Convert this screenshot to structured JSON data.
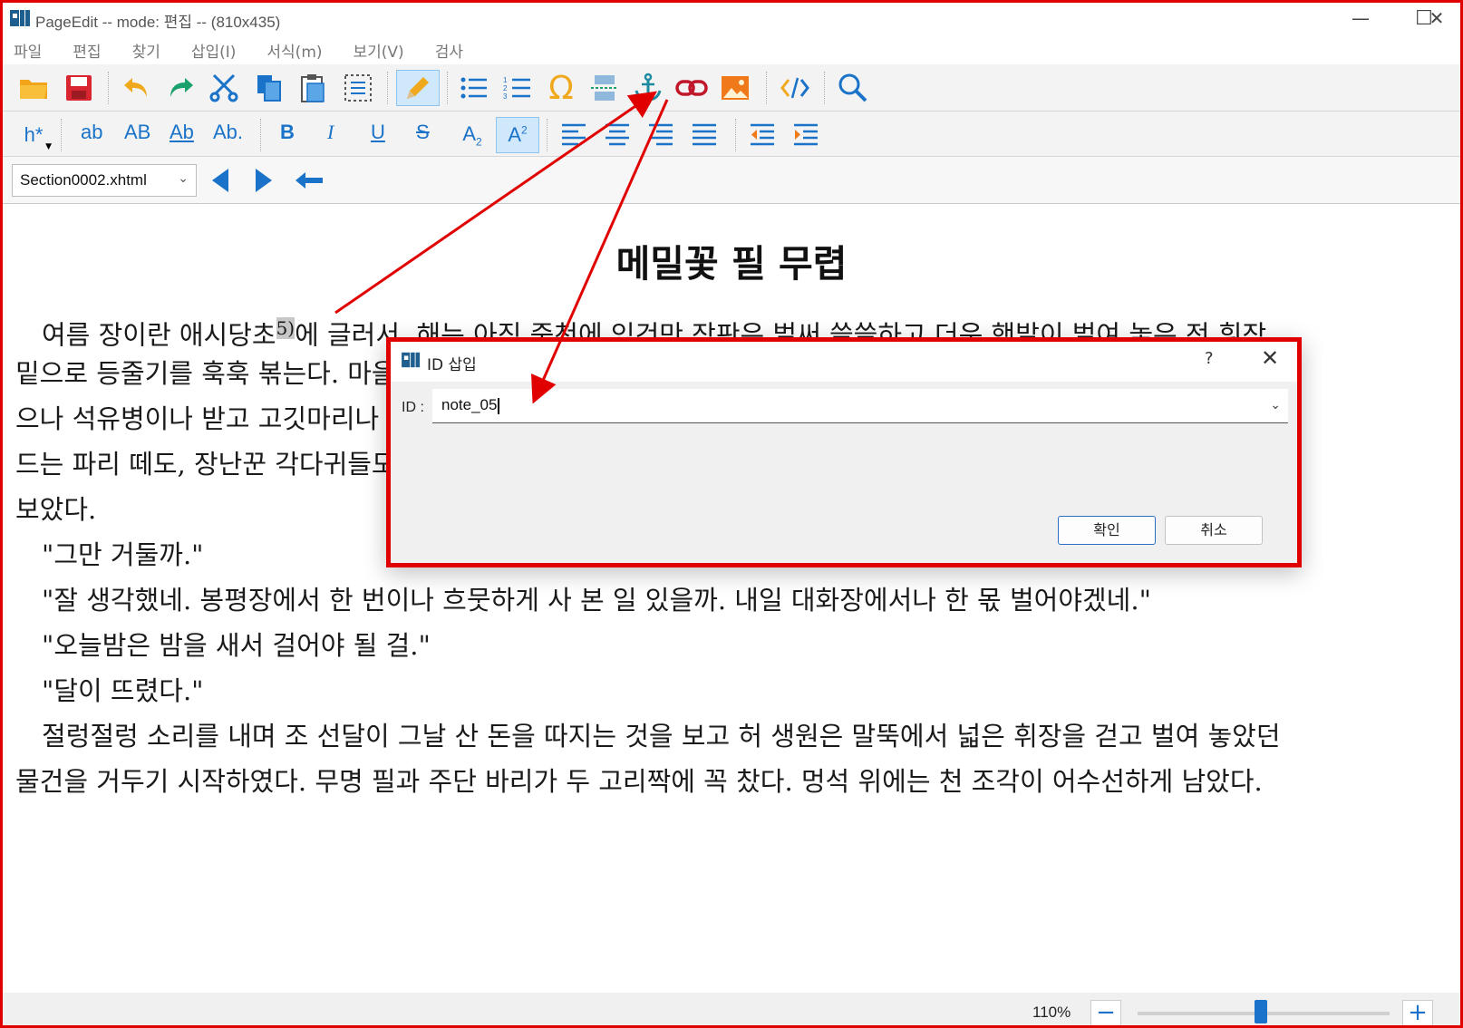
{
  "window": {
    "title": "PageEdit -- mode: 편집 -- (810x435)",
    "minimize": "—",
    "maximize": "☐",
    "close": "✕"
  },
  "menu": [
    "파일",
    "편집",
    "찾기",
    "삽입(I)",
    "서식(m)",
    "보기(V)",
    "검사"
  ],
  "toolbar": {
    "heading_label": "h*",
    "case_buttons": [
      "ab",
      "AB",
      "Ab",
      "Ab."
    ],
    "bold": "B",
    "italic": "I",
    "underline": "U",
    "strike": "S"
  },
  "navbar": {
    "current_file": "Section0002.xhtml"
  },
  "document": {
    "title": "메밀꽃 필 무렵",
    "para1_line1_a": "　여름 장이란 애시당초",
    "para1_sup": "5)",
    "para1_line1_b": "에 글러서, 해는 아직 중천에 있건만 장판은 벌써 쓸쓸하고 더운 햇발이 벌여 놓은 전 휘장",
    "para1_line2": "밑으로 등줄기를 훅훅 볶는다. 마을 사람들은 거진 돌아간 뒤요, 팔리지 못한 나뭇군패가 길거리고들 있",
    "para1_line3": "으나 석유병이나 받고 고깃마리나 사면 족할 이 축들을 바라고 언제까지든지 버티고 있을 수는 없다. 추근스럽게 날아",
    "para1_line4": "드는 파리 떼도, 장난꾼 각다귀들도 귀찮다. 얽둑배기요, 왼손잡이인 드팀전의 허생원은 기어이 동업의 조선달을 낚아",
    "para1_line5": "보았다.",
    "line_a": "　\"그만 거둘까.\"",
    "line_b": "　\"잘 생각했네. 봉평장에서 한 번이나 흐뭇하게 사 본 일 있을까. 내일 대화장에서나 한 몫 벌어야겠네.\"",
    "line_c": "　\"오늘밤은 밤을 새서 걸어야 될 걸.\"",
    "line_d": "　\"달이 뜨렸다.\"",
    "para2_line1": "　절렁절렁 소리를 내며 조 선달이 그날 산 돈을 따지는 것을 보고 허 생원은 말뚝에서 넓은 휘장을 걷고 벌여 놓았던",
    "para2_line2": "물건을 거두기 시작하였다. 무명 필과 주단 바리가 두 고리짝에 꼭 찼다. 멍석 위에는 천 조각이 어수선하게 남았다."
  },
  "dialog": {
    "title": "ID 삽입",
    "help": "?",
    "close": "✕",
    "id_label": "ID :",
    "id_value": "note_05",
    "ok": "확인",
    "cancel": "취소"
  },
  "status": {
    "zoom": "110%",
    "zoom_out": "−",
    "zoom_in": "+",
    "zoom_level": 0.49
  },
  "colors": {
    "accent": "#1a73c9",
    "annotation": "#e00000",
    "anchor_teal": "#1e8aa0"
  }
}
